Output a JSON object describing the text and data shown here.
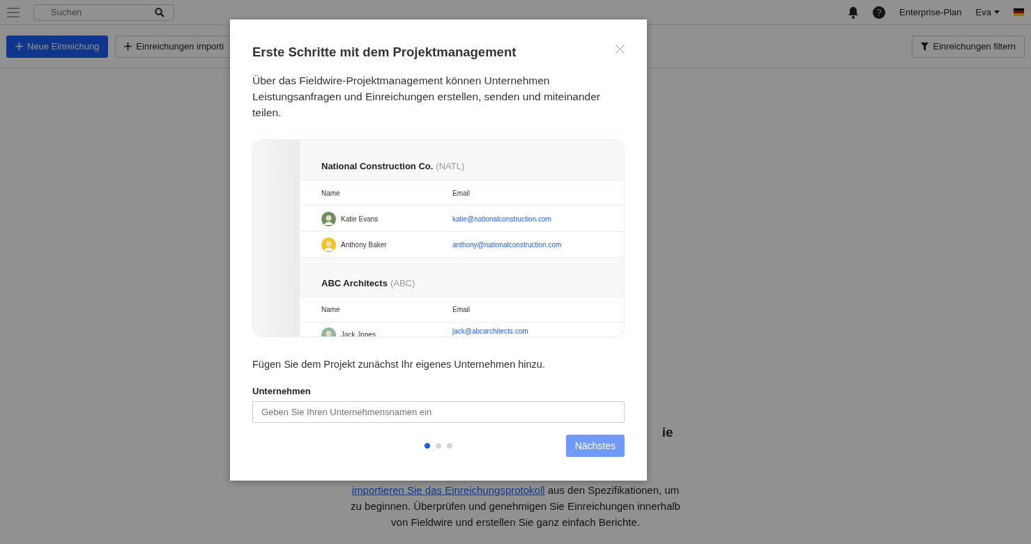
{
  "topbar": {
    "search": {
      "placeholder": "Suchen"
    },
    "plan": "Enterprise-Plan",
    "user": "Eva"
  },
  "toolbar": {
    "buttons": [
      {
        "kind": "primary",
        "label": "Neue Einreichung"
      },
      {
        "kind": "secondary",
        "label": "Einreichungen importi"
      }
    ],
    "filter": "Einreichungen filtern"
  },
  "empty_state": {
    "heading": "ie",
    "link": "importieren Sie das Einreichungsprotokoll",
    "text_after": " aus den Spezifikationen, um zu beginnen. Überprüfen und genehmigen Sie Einreichungen innerhalb von Fieldwire und erstellen Sie ganz einfach Berichte."
  },
  "modal": {
    "title": "Erste Schritte mit dem Projektmanagement",
    "intro": "Über das Fieldwire-Projektmanagement können Unternehmen Leistungsanfragen und Einreichungen erstellen, senden und miteinander teilen.",
    "preview": {
      "companies": [
        {
          "name": "National Construction Co.",
          "code": "(NATL)",
          "columns": [
            "Name",
            "Email"
          ],
          "rows": [
            {
              "name": "Katie Evans",
              "email": "katie@nationalconstruction.com"
            },
            {
              "name": "Anthony Baker",
              "email": "anthony@nationalconstruction.com"
            }
          ]
        },
        {
          "name": "ABC Architects",
          "code": "(ABC)",
          "columns": [
            "Name",
            "Email"
          ],
          "rows": [
            {
              "name": "Jack Jones",
              "email": "jack@abcarchitects.com"
            }
          ]
        }
      ]
    },
    "prompt": "Fügen Sie dem Projekt zunächst Ihr eigenes Unternehmen hinzu.",
    "field": {
      "label": "Unternehmen",
      "placeholder": "Geben Sie Ihren Unternehmensnamen ein"
    },
    "steps": [
      {
        "selected": true
      },
      {
        "selected": false
      },
      {
        "selected": false
      }
    ],
    "next": "Nächstes"
  }
}
